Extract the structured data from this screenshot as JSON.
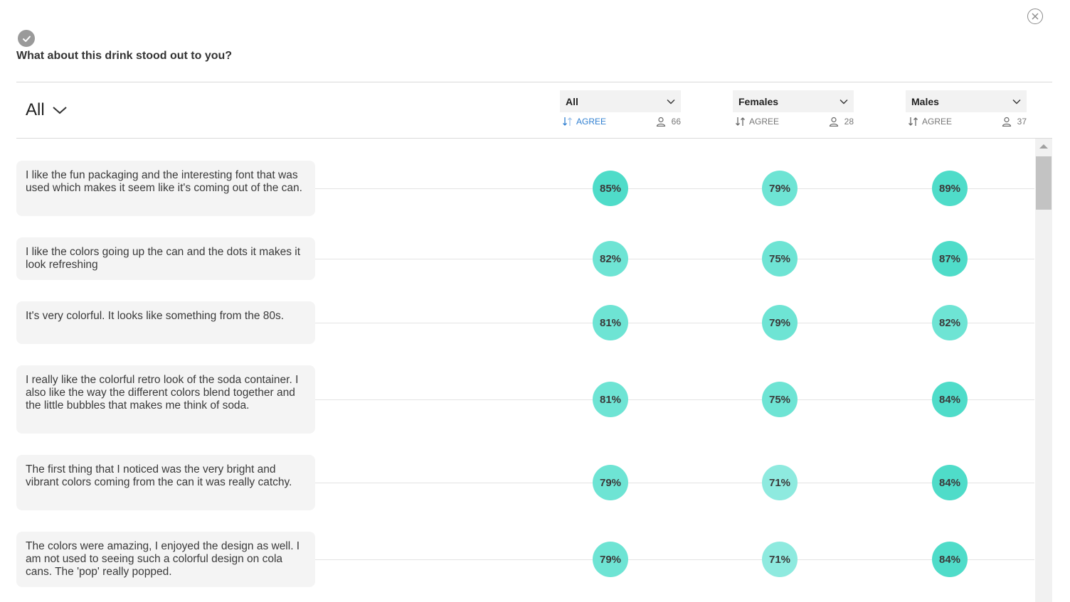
{
  "question": "What about this drink stood out to you?",
  "filter": {
    "selected": "All"
  },
  "segments": [
    {
      "label": "All",
      "sort_label": "AGREE",
      "count": "66",
      "active": true
    },
    {
      "label": "Females",
      "sort_label": "AGREE",
      "count": "28",
      "active": false
    },
    {
      "label": "Males",
      "sort_label": "AGREE",
      "count": "37",
      "active": false
    }
  ],
  "rows": [
    {
      "text": "I like the fun packaging and the interesting font that was used which makes it seem like it's coming out of the can.",
      "values": [
        "85%",
        "79%",
        "89%"
      ]
    },
    {
      "text": "I like the colors going up the can and the dots it makes it look refreshing",
      "values": [
        "82%",
        "75%",
        "87%"
      ]
    },
    {
      "text": "It's very colorful. It looks like something from the 80s.",
      "values": [
        "81%",
        "79%",
        "82%"
      ]
    },
    {
      "text": "I really like the colorful retro look of the soda container. I also like the way the different colors blend together and the little bubbles that makes me think of soda.",
      "values": [
        "81%",
        "75%",
        "84%"
      ]
    },
    {
      "text": "The first thing that I noticed was the very bright and vibrant colors coming from the can it was really catchy.",
      "values": [
        "79%",
        "71%",
        "84%"
      ]
    },
    {
      "text": "The colors were amazing, I enjoyed the design as well. I am not used to seeing such a colorful design on cola cans. The 'pop' really popped.",
      "values": [
        "79%",
        "71%",
        "84%"
      ]
    }
  ],
  "colors": {
    "high": "#4fdcc9",
    "mid": "#6ee4d4",
    "low": "#8eeadf",
    "accent": "#2f7fd1"
  },
  "icons": {
    "close": "close-icon",
    "check": "check-icon",
    "chevron": "chevron-down-icon",
    "sort": "sort-icon",
    "person": "person-icon"
  }
}
